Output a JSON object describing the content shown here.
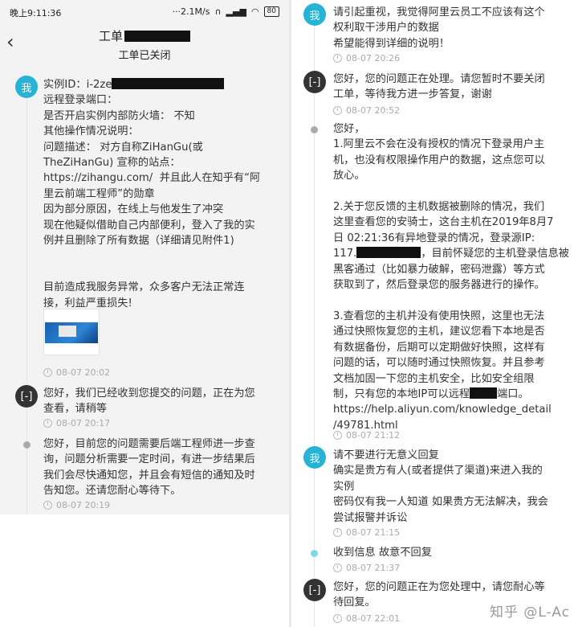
{
  "status": {
    "time": "晚上9:11:36",
    "net": "···2.1M/s",
    "battery": "80"
  },
  "header": {
    "title": "工单",
    "subtitle": "工单已关闭"
  },
  "avatar_me": "我",
  "msg1": {
    "l1_prefix": "实例ID：i-2ze",
    "rest": "远程登录端口：\n是否开启实例内部防火墙： 不知\n其他操作情况说明：\n问题描述： 对方自称ZiHanGu(或\nTheZiHanGu) 宣称的站点：\nhttps://zihangu.com/  并且此人在知乎有“阿\n里云前端工程师”的勋章\n因为部分原因，在线上与他发生了冲突\n现在他疑似借助自己内部便利，登入了我的实\n例并且删除了所有数据（详细请见附件1)\n\n\n目前造成我服务异常，众多客户无法正常连\n接，利益严重损失!",
    "time": "08-07 20:02"
  },
  "msg2": {
    "text": "您好，我们已经收到您提交的问题，正在为您\n查看，请稍等",
    "time": "08-07 20:17"
  },
  "msg3": {
    "text": "您好，目前您的问题需要后端工程师进一步查\n询，问题分析需要一定时间，有进一步结果后\n我们会尽快通知您，并且会有短信的通知及时\n告知您。还请您耐心等待下。",
    "time": "08-07 20:19"
  },
  "msg4": {
    "text": "请引起重视，我觉得阿里云员工不应该有这个\n权利取干涉用户的数据\n希望能得到详细的说明！",
    "time": "08-07 20:26"
  },
  "msg5": {
    "text": "您好，您的问题正在处理。请您暂时不要关闭\n工单，等待我方进一步答复，谢谢",
    "time": "08-07 20:52"
  },
  "msg6": {
    "p1": "您好，\n1.阿里云不会在没有授权的情况下登录用户主\n机，也没有权限操作用户的数据，这点您可以\n放心。\n\n2.关于您反馈的主机数据被删除的情况，我们\n这里查看您的安骑士，这台主机在2019年8月7\n日 02:21:36有异地登录的情况，登录源IP:",
    "ip_prefix": "117.",
    "p2": "，目前怀疑您的主机登录信息被\n黑客通过（比如暴力破解，密码泄露）等方式\n获取到了，然后登录您的服务器进行的操作。\n\n3.查看您的主机并没有使用快照，这里也无法\n通过快照恢复您的主机，建议您看下本地是否\n有数据备份，后期可以定期做好快照，这样有\n问题的话，可以随时通过快照恢复。并且参考\n文档加固一下您的主机安全，比如安全组限",
    "p3a": "制，只有您的本地IP可以远程",
    "p3b": "端口。",
    "p4": "https://help.aliyun.com/knowledge_detail\n/49781.html",
    "time": "08-07 21:12"
  },
  "msg7": {
    "text": "请不要进行无意义回复\n确实是贵方有人(或者提供了渠道)来进入我的\n实例\n密码仅有我一人知道 如果贵方无法解决，我会\n尝试报警并诉讼",
    "time": "08-07 21:15"
  },
  "msg8": {
    "text": "收到信息 故意不回复",
    "time": "08-07 21:37"
  },
  "msg9": {
    "text": "您好，您的问题正在为您处理中，请您耐心等\n待回复。",
    "time": "08-07 22:01"
  },
  "watermark": "知乎 @L-Ac"
}
